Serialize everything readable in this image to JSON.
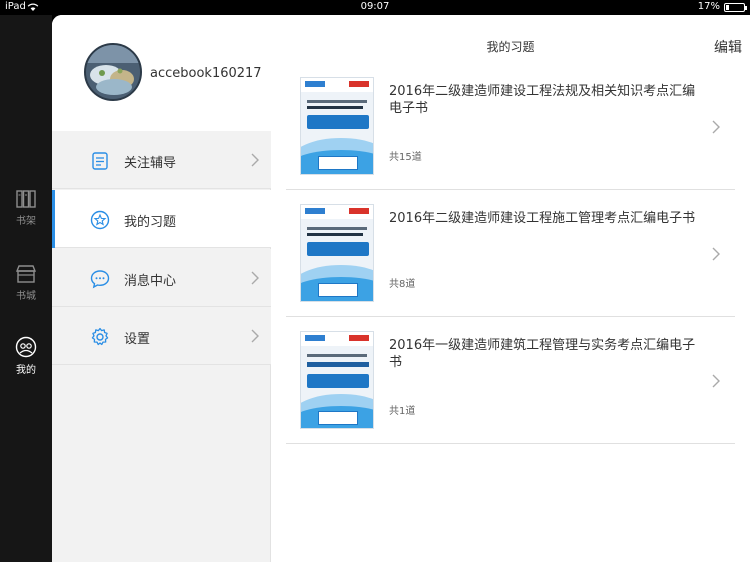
{
  "status_bar": {
    "carrier": "iPad",
    "time": "09:07",
    "battery": "17%",
    "battery_level": 0.17
  },
  "tab_bar": {
    "tabs": [
      {
        "label": "书架",
        "icon": "bookshelf-icon",
        "active": false
      },
      {
        "label": "书城",
        "icon": "store-icon",
        "active": false
      },
      {
        "label": "我的",
        "icon": "profile-icon",
        "active": true
      }
    ]
  },
  "profile": {
    "username": "accebook160217"
  },
  "menu": {
    "items": [
      {
        "label": "关注辅导",
        "icon": "document-icon",
        "active": false
      },
      {
        "label": "我的习题",
        "icon": "star-icon",
        "active": true
      },
      {
        "label": "消息中心",
        "icon": "chat-icon",
        "active": false
      },
      {
        "label": "设置",
        "icon": "gear-icon",
        "active": false
      }
    ]
  },
  "content": {
    "title": "我的习题",
    "edit_label": "编辑",
    "books": [
      {
        "title": "2016年二级建造师建设工程法规及相关知识考点汇编电子书",
        "count": "共15道"
      },
      {
        "title": "2016年二级建造师建设工程施工管理考点汇编电子书",
        "count": "共8道"
      },
      {
        "title": "2016年一级建造师建筑工程管理与实务考点汇编电子书",
        "count": "共1道"
      }
    ]
  },
  "colors": {
    "accent": "#2a8ee5",
    "rail": "#161616",
    "menu_bg": "#f2f2f2"
  }
}
